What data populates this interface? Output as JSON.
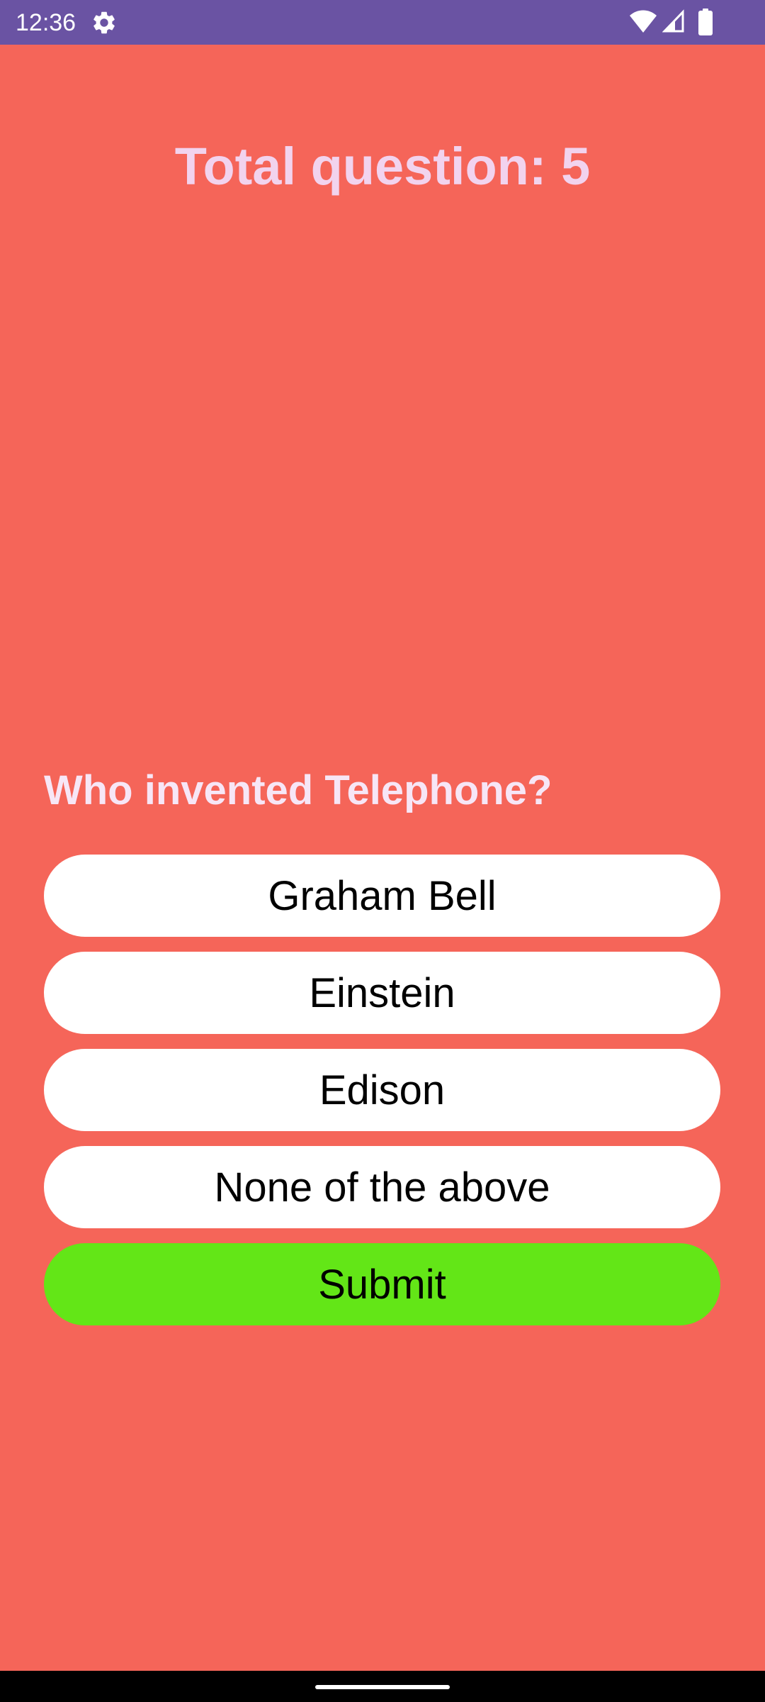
{
  "status_bar": {
    "time": "12:36",
    "icons": [
      "settings-icon",
      "wifi-icon",
      "signal-icon",
      "battery-icon"
    ],
    "background": "#6A53A3"
  },
  "quiz": {
    "total_label": "Total question: 5",
    "question": "Who invented Telephone?",
    "options": [
      {
        "label": "Graham Bell"
      },
      {
        "label": "Einstein"
      },
      {
        "label": "Edison"
      },
      {
        "label": "None of the above"
      }
    ],
    "submit_label": "Submit"
  },
  "colors": {
    "background": "#F56559",
    "title": "#F2D3EE",
    "option_bg": "#FFFFFF",
    "submit_bg": "#63E617"
  }
}
